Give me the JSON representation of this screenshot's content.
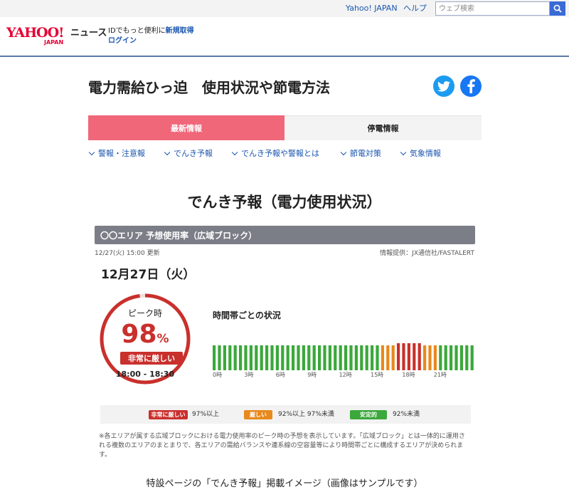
{
  "topbar": {
    "yahoo_japan_link": "Yahoo! JAPAN",
    "help_link": "ヘルプ",
    "search_placeholder": "ウェブ検索"
  },
  "header": {
    "logo_main": "YAHOO!",
    "logo_sub": "JAPAN",
    "logo_service": "ニュース",
    "id_prefix": "IDでもっと便利に",
    "register_link": "新規取得",
    "login_link": "ログイン"
  },
  "page": {
    "title": "電力需給ひっ迫　使用状況や節電方法"
  },
  "tabs": [
    {
      "label": "最新情報",
      "active": true
    },
    {
      "label": "停電情報",
      "active": false
    }
  ],
  "anchors": [
    {
      "label": "警報・注意報"
    },
    {
      "label": "でんき予報"
    },
    {
      "label": "でんき予報や警報とは"
    },
    {
      "label": "節電対策"
    },
    {
      "label": "気象情報"
    }
  ],
  "forecast": {
    "heading": "でんき予報（電力使用状況）",
    "area_title": "〇〇エリア 予想使用率（広域ブロック）",
    "updated": "12/27(火) 15:00 更新",
    "provider": "情報提供：JX通信社/FASTALERT",
    "date": "12月27日（火）",
    "peak_label": "ピーク時",
    "peak_value": "98",
    "peak_unit": "%",
    "peak_status": "非常に厳しい",
    "peak_time": "18:00 - 18:30",
    "chart_title": "時間帯ごとの状況",
    "hour_labels": [
      "0時",
      "3時",
      "6時",
      "9時",
      "12時",
      "15時",
      "18時",
      "21時"
    ],
    "slots": [
      "g",
      "g",
      "g",
      "g",
      "g",
      "g",
      "g",
      "g",
      "g",
      "g",
      "g",
      "g",
      "g",
      "g",
      "g",
      "g",
      "g",
      "g",
      "g",
      "g",
      "g",
      "g",
      "g",
      "g",
      "g",
      "g",
      "g",
      "g",
      "g",
      "g",
      "g",
      "g",
      "o",
      "o",
      "o",
      "r",
      "r",
      "r",
      "r",
      "r",
      "o",
      "o",
      "o",
      "g",
      "g",
      "g",
      "g",
      "g",
      "g",
      "g"
    ]
  },
  "legend": [
    {
      "badge": "非常に厳しい",
      "text": "97%以上",
      "color": "#c9302c"
    },
    {
      "badge": "厳しい",
      "text": "92%以上 97%未満",
      "color": "#e8891c"
    },
    {
      "badge": "安定的",
      "text": "92%未満",
      "color": "#3aa83a"
    }
  ],
  "colors": {
    "green": "#3aa83a",
    "orange": "#e8891c",
    "red": "#c9302c",
    "tab_active": "#f0677a"
  },
  "footnote": "※各エリアが属する広域ブロックにおける電力使用率のピーク時の予想を表示しています。「広域ブロック」とは一体的に運用される複数のエリアのまとまりで、各エリアの需給バランスや連系線の空容量等により時間帯ごとに構成するエリアが決められます。",
  "caption": "特設ページの「でんき予報」掲載イメージ（画像はサンプルです）"
}
